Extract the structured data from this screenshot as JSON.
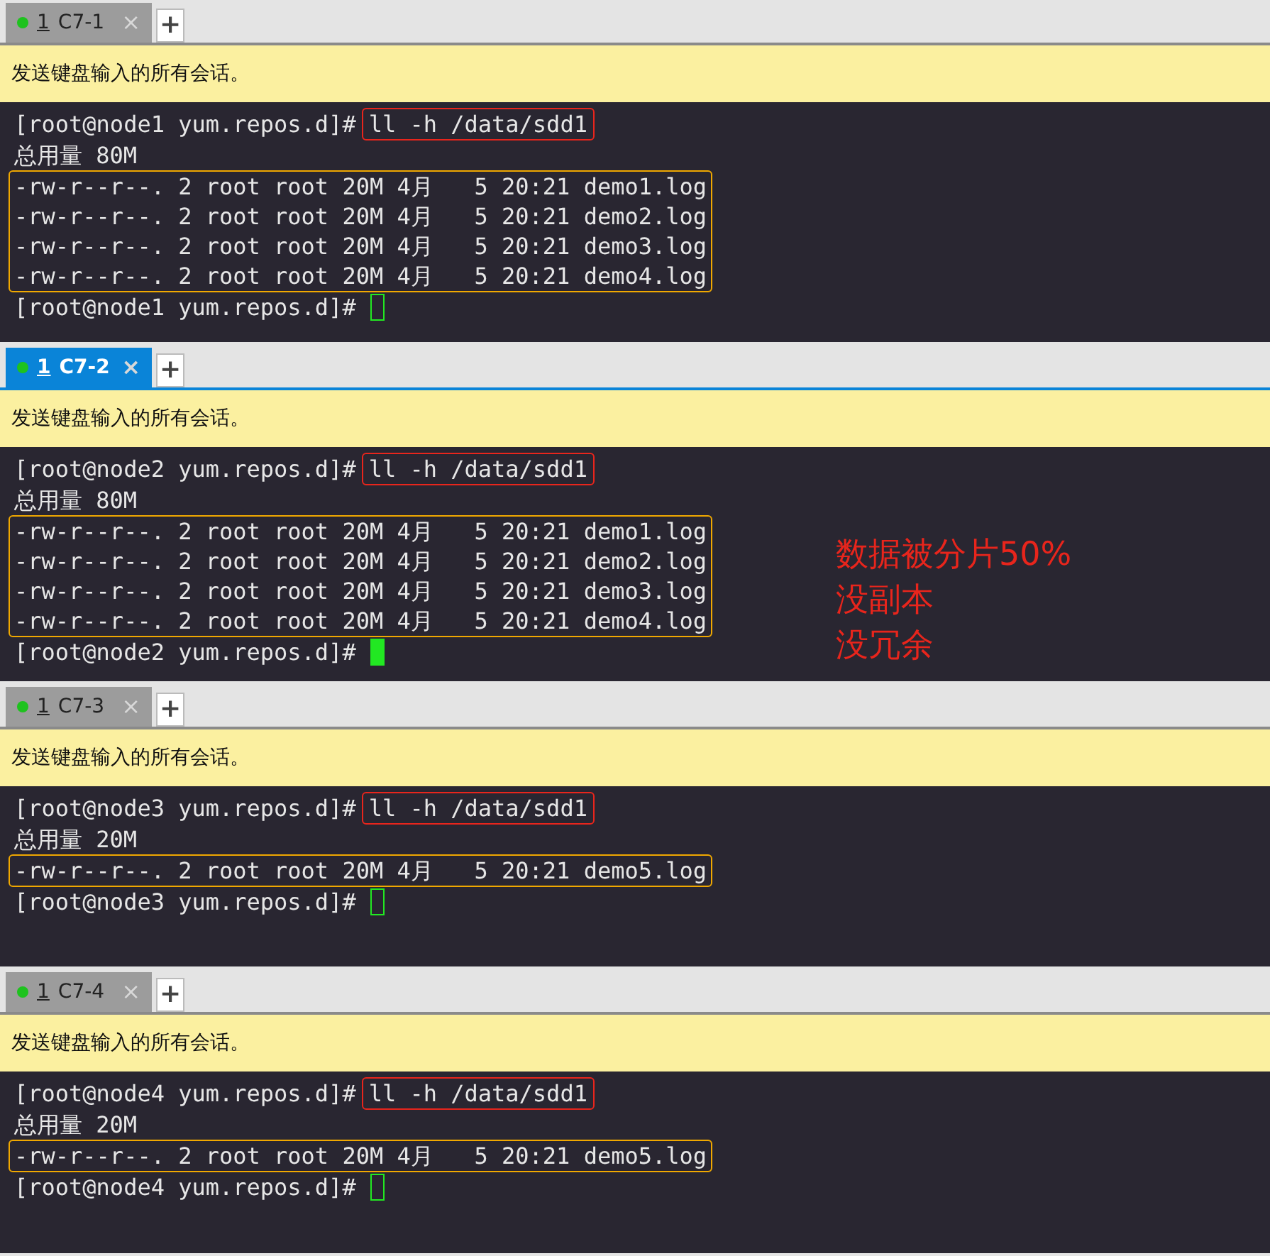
{
  "sessions": [
    {
      "tab": {
        "number": "1",
        "name": "C7-1",
        "selected": false,
        "close": "×"
      },
      "add_tab": "+",
      "banner": "发送键盘输入的所有会话。",
      "prompt": "[root@node1 yum.repos.d]#",
      "command": "ll -h /data/sdd1",
      "total": "总用量 80M",
      "files": [
        "-rw-r--r--. 2 root root 20M 4月   5 20:21 demo1.log",
        "-rw-r--r--. 2 root root 20M 4月   5 20:21 demo2.log",
        "-rw-r--r--. 2 root root 20M 4月   5 20:21 demo3.log",
        "-rw-r--r--. 2 root root 20M 4月   5 20:21 demo4.log"
      ],
      "final_prompt": "[root@node1 yum.repos.d]#"
    },
    {
      "tab": {
        "number": "1",
        "name": "C7-2",
        "selected": true,
        "close": "×"
      },
      "add_tab": "+",
      "banner": "发送键盘输入的所有会话。",
      "prompt": "[root@node2 yum.repos.d]#",
      "command": "ll -h /data/sdd1",
      "total": "总用量 80M",
      "files": [
        "-rw-r--r--. 2 root root 20M 4月   5 20:21 demo1.log",
        "-rw-r--r--. 2 root root 20M 4月   5 20:21 demo2.log",
        "-rw-r--r--. 2 root root 20M 4月   5 20:21 demo3.log",
        "-rw-r--r--. 2 root root 20M 4月   5 20:21 demo4.log"
      ],
      "final_prompt": "[root@node2 yum.repos.d]#",
      "annotation": [
        "数据被分片50%",
        "没副本",
        "没冗余"
      ]
    },
    {
      "tab": {
        "number": "1",
        "name": "C7-3",
        "selected": false,
        "close": "×"
      },
      "add_tab": "+",
      "banner": "发送键盘输入的所有会话。",
      "prompt": "[root@node3 yum.repos.d]#",
      "command": "ll -h /data/sdd1",
      "total": "总用量 20M",
      "files": [
        "-rw-r--r--. 2 root root 20M 4月   5 20:21 demo5.log"
      ],
      "final_prompt": "[root@node3 yum.repos.d]#"
    },
    {
      "tab": {
        "number": "1",
        "name": "C7-4",
        "selected": false,
        "close": "×"
      },
      "add_tab": "+",
      "banner": "发送键盘输入的所有会话。",
      "prompt": "[root@node4 yum.repos.d]#",
      "command": "ll -h /data/sdd1",
      "total": "总用量 20M",
      "files": [
        "-rw-r--r--. 2 root root 20M 4月   5 20:21 demo5.log"
      ],
      "final_prompt": "[root@node4 yum.repos.d]#"
    }
  ]
}
